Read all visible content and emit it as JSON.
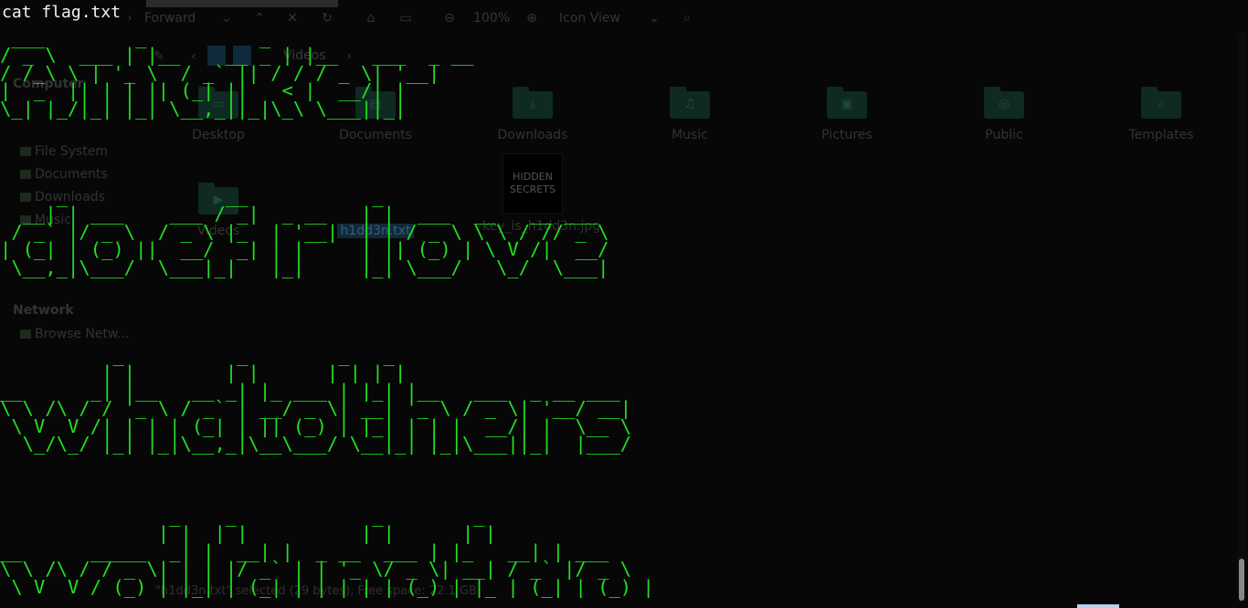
{
  "terminal": {
    "prompt_command": "cat flag.txt",
    "ascii_art_blocks": [
      " ___        _          _             \n/ _ \\  ___ | |__    __ _ | |__   ___  _ __ \n/ /_\\ \\ | '_ \\  / _` || / / / _ \\| '__|\n|  _  || | | || (_| ||   < |  __/| |   \n\\_| |_/|_| |_| \\__,_||_|\\_\\ \\___||_|   ",
      "     _              __           _                \n  __| | ___    ___ / _|  _ __   | |  ___  __   __ ___ \n / _` |/ _ \\  / _ \\ |_  | '__|  | | / _ \\ \\ \\ / // _ \\\n| (_| | (_) ||  __/  _| | |     | || (_) | \\ V /|  __/\n \\__,_|\\___/  \\___|_|   |_|     |_| \\___/   \\_/  \\___|",
      "          _          _        _   _\n         | |        | |      | | | |\n__      _| |__   __ _| |_ ___ | |_| |__   ___  _ __ ___\n\\ \\ /\\ / / '_ \\ / _` | __/ _ \\| __| '_ \\ / _ \\| '__/ __|\n \\ V  V /| | | | (_| | || (_) | |_| | | |  __/| |  \\__ \\\n  \\_/\\_/ |_| |_|\\__,_|\\__\\___/ \\__|_| |_|\\___||_|  |___/",
      "               _    _            _        _\n              | |  | |          | |      | |\n__      _____  _| |  __| |  _ __  ___ | |_   __| | ___\n\\ \\ /\\ / / _ \\| | | |/ _` | | '_ \\/ _ \\| __| / _` |/ _ \\\n \\ V  V / (_) | |_| | (_| | | | | | (_) | |_ | (_| | (_) |"
    ]
  },
  "file_manager": {
    "toolbar": {
      "forward_label": "Forward",
      "zoom_level": "100%",
      "view_mode": "Icon View"
    },
    "pathbar": {
      "current": "Videos"
    },
    "sidebar": {
      "computer_heading": "Computer",
      "items": [
        "File System",
        "Documents",
        "Downloads",
        "Music"
      ],
      "network_heading": "Network",
      "network_items": [
        "Browse Netw..."
      ]
    },
    "icons": [
      {
        "label": "Desktop",
        "glyph": "▭"
      },
      {
        "label": "Documents",
        "glyph": "▤"
      },
      {
        "label": "Downloads",
        "glyph": "⤓"
      },
      {
        "label": "Music",
        "glyph": "♫"
      },
      {
        "label": "Pictures",
        "glyph": "▣"
      },
      {
        "label": "Public",
        "glyph": "◎"
      },
      {
        "label": "Templates",
        "glyph": "⌕"
      },
      {
        "label": "Videos",
        "glyph": "▶"
      }
    ],
    "selected_file": "h1dd3n.txt",
    "image_file": {
      "label": "key_is_h1dd3n.jpg",
      "thumb_text": "HIDDEN SECRETS"
    },
    "statusbar": "\"h1dd3n.txt\" selected (29 bytes), Free space: 22.1 GB"
  }
}
